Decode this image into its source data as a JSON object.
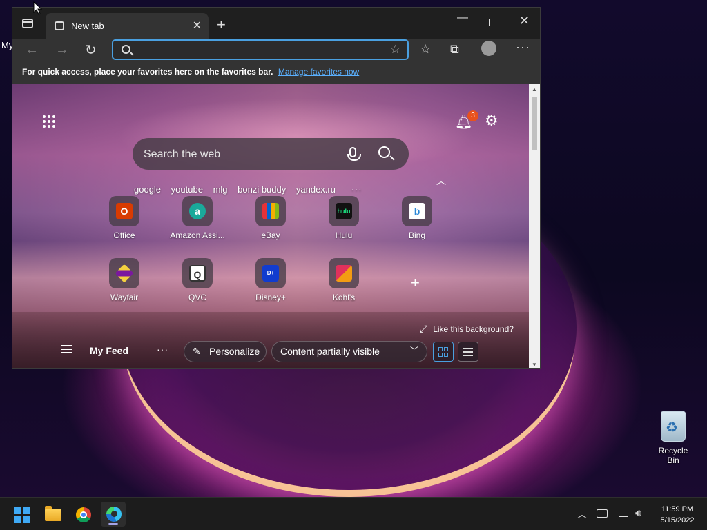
{
  "desktop": {
    "partial_label": "My",
    "recycle_bin_label": "Recycle Bin"
  },
  "browser": {
    "tab": {
      "title": "New tab",
      "close_icon": "close-icon"
    },
    "toolbar": {
      "address_value": "",
      "address_placeholder": ""
    },
    "favbar": {
      "text": "For quick access, place your favorites here on the favorites bar.",
      "link": "Manage favorites now"
    },
    "newtab": {
      "notification_count": "3",
      "search_placeholder": "Search the web",
      "quick_links": [
        "google",
        "youtube",
        "mlg",
        "bonzi buddy",
        "yandex.ru"
      ],
      "more_links": "···",
      "tiles_row1": [
        {
          "label": "Office",
          "icon": "office-icon",
          "color": "#d83b01"
        },
        {
          "label": "Amazon Assi...",
          "icon": "amazon-assistant-icon",
          "color": "#1aa99a"
        },
        {
          "label": "eBay",
          "icon": "ebay-icon",
          "color": "#e53238"
        },
        {
          "label": "Hulu",
          "icon": "hulu-icon",
          "color": "#1ce783"
        },
        {
          "label": "Bing",
          "icon": "bing-icon",
          "color": "#2b88d8"
        }
      ],
      "tiles_row2": [
        {
          "label": "Wayfair",
          "icon": "wayfair-icon",
          "color": "#7b189f"
        },
        {
          "label": "QVC",
          "icon": "qvc-icon",
          "color": "#ffffff"
        },
        {
          "label": "Disney+",
          "icon": "disney-plus-icon",
          "color": "#113ccf"
        },
        {
          "label": "Kohl's",
          "icon": "kohls-icon",
          "color": "#e0315c"
        }
      ],
      "like_background": "Like this background?",
      "feed": {
        "title": "My Feed",
        "personalize": "Personalize",
        "content_visibility": "Content partially visible"
      }
    }
  },
  "taskbar": {
    "time": "11:59 PM",
    "date": "5/15/2022"
  }
}
